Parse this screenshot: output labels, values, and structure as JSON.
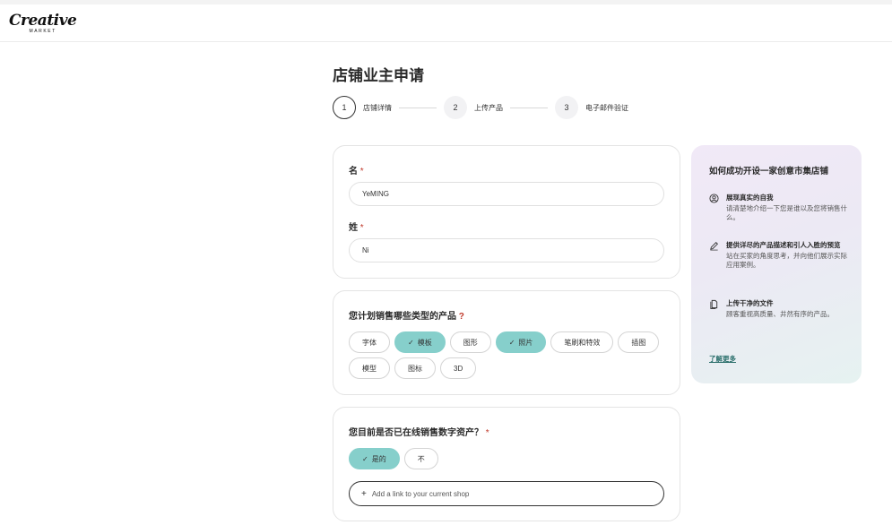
{
  "brand": {
    "name": "Creative",
    "subtitle": "MARKET"
  },
  "page": {
    "title": "店铺业主申请"
  },
  "stepper": [
    {
      "number": "1",
      "label": "店铺详情"
    },
    {
      "number": "2",
      "label": "上传产品"
    },
    {
      "number": "3",
      "label": "电子邮件验证"
    }
  ],
  "form": {
    "first_name": {
      "label": "名",
      "required_mark": "*",
      "value": "YeMING"
    },
    "last_name": {
      "label": "姓",
      "required_mark": "*",
      "value": "Ni"
    },
    "product_types": {
      "question": "您计划销售哪些类型的产品",
      "mark": "?",
      "options": [
        {
          "label": "字体",
          "selected": false
        },
        {
          "label": "模板",
          "selected": true
        },
        {
          "label": "图形",
          "selected": false
        },
        {
          "label": "照片",
          "selected": true
        },
        {
          "label": "笔刷和特效",
          "selected": false
        },
        {
          "label": "插图",
          "selected": false
        },
        {
          "label": "模型",
          "selected": false
        },
        {
          "label": "图标",
          "selected": false
        },
        {
          "label": "3D",
          "selected": false
        }
      ]
    },
    "selling_online": {
      "question": "您目前是否已在线销售数字资产？",
      "required_mark": "*",
      "yes_label": "是的",
      "no_label": "不",
      "link_placeholder": "Add a link to your current shop"
    }
  },
  "tips": {
    "title": "如何成功开设一家创意市集店铺",
    "items": [
      {
        "title": "展现真实的自我",
        "text": "请清楚地介绍一下您是谁以及您将销售什么。"
      },
      {
        "title": "提供详尽的产品描述和引人入胜的预览",
        "text": "站在买家的角度思考，并向他们展示实际应用案例。"
      },
      {
        "title": "上传干净的文件",
        "text": "顾客重视高质量、井然有序的产品。"
      }
    ],
    "learn_more": "了解更多"
  },
  "icons": {
    "check": "✓",
    "plus": "+"
  }
}
